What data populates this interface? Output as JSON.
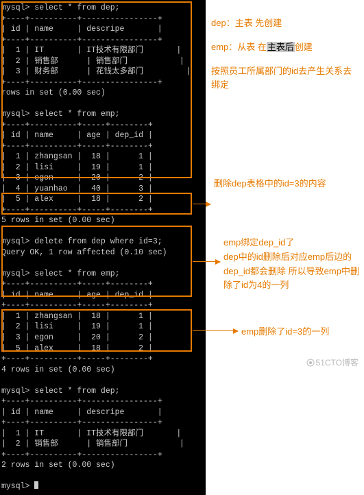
{
  "terminal": {
    "prompt": "mysql>",
    "q1": "select * from dep;",
    "dep_hdr_id": "id",
    "dep_hdr_name": "name",
    "dep_hdr_desc": "descripe",
    "dep_rows": [
      {
        "id": "1",
        "name": "IT",
        "desc": "IT技术有限部门"
      },
      {
        "id": "2",
        "name": "销售部",
        "desc": "销售部门"
      },
      {
        "id": "3",
        "name": "财务部",
        "desc": "花钱太多部门"
      }
    ],
    "rows_result_a": "rows in set (0.00 sec)",
    "q2": "select * from emp;",
    "emp_hdr_id": "id",
    "emp_hdr_name": "name",
    "emp_hdr_age": "age",
    "emp_hdr_dep": "dep_id",
    "emp_rows": [
      {
        "id": "1",
        "name": "zhangsan",
        "age": "18",
        "dep": "1"
      },
      {
        "id": "2",
        "name": "lisi",
        "age": "19",
        "dep": "1"
      },
      {
        "id": "3",
        "name": "egon",
        "age": "20",
        "dep": "2"
      },
      {
        "id": "4",
        "name": "yuanhao",
        "age": "40",
        "dep": "3"
      },
      {
        "id": "5",
        "name": "alex",
        "age": "18",
        "dep": "2"
      }
    ],
    "rows5": "5 rows in set (0.00 sec)",
    "q3": "delete from dep where id=3;",
    "q3_result": "Query OK, 1 row affected (0.10 sec)",
    "q4": "select * from emp;",
    "emp_rows2": [
      {
        "id": "1",
        "name": "zhangsan",
        "age": "18",
        "dep": "1"
      },
      {
        "id": "2",
        "name": "lisi",
        "age": "19",
        "dep": "1"
      },
      {
        "id": "3",
        "name": "egon",
        "age": "20",
        "dep": "2"
      },
      {
        "id": "5",
        "name": "alex",
        "age": "18",
        "dep": "2"
      }
    ],
    "rows4": "4 rows in set (0.00 sec)",
    "q5": "select * from dep;",
    "dep_rows2": [
      {
        "id": "1",
        "name": "IT",
        "desc": "IT技术有限部门"
      },
      {
        "id": "2",
        "name": "销售部",
        "desc": "销售部门"
      }
    ],
    "rows2": "2 rows in set (0.00 sec)"
  },
  "annot": {
    "a1a": "dep：主表 先创建",
    "a1b_pre": "emp：从表 在",
    "a1b_hl": "主表后",
    "a1b_post": "创建",
    "a1c": "按照员工所属部门的id去产生关系去绑定",
    "a2": "删除dep表格中的id=3的内容",
    "a3": "emp绑定dep_id了\ndep中的id删除后对应emp后边的dep_id都会删除 所以导致emp中删除了id为4的一列",
    "a4": "emp删除了id=3的一列"
  },
  "watermark": "51CTO博客"
}
